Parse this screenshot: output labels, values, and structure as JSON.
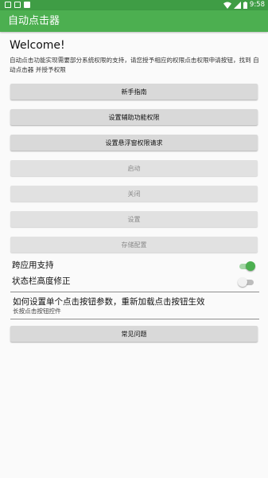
{
  "statusbar": {
    "time": "9:58"
  },
  "appbar": {
    "title": "自动点击器"
  },
  "main": {
    "welcome": "Welcome!",
    "description": "自动点击功能实现需要部分系统权限的支持，请您授予相应的权限点击权限申请按钮，找到 自动点击器 并授予权限"
  },
  "buttons": {
    "guide": "新手指南",
    "accessibility": "设置辅助功能权限",
    "overlay": "设置悬浮窗权限请求",
    "start": "启动",
    "close": "关闭",
    "settings": "设置",
    "save_config": "存储配置",
    "faq": "常见问题"
  },
  "switches": {
    "cross_app": {
      "label": "跨应用支持",
      "on": true
    },
    "statusbar_fix": {
      "label": "状态栏高度修正",
      "on": false
    }
  },
  "tip": {
    "title": "如何设置单个点击按钮参数，重新加载点击按钮生效",
    "subtitle": "长按点击按钮控件"
  },
  "colors": {
    "primary": "#4caf50",
    "primary_dark": "#3f9d45",
    "button": "#d9d9d9"
  }
}
